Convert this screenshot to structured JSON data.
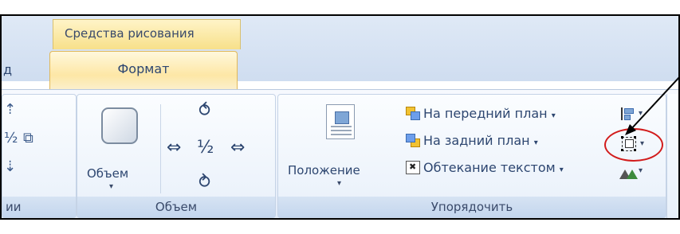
{
  "context_tab_header": "Средства рисования",
  "tabs": {
    "previous_partial": "д",
    "format": "Формат"
  },
  "groups": {
    "left_partial": {
      "label": "ии"
    },
    "volume": {
      "label": "Объем",
      "button_label": "Объем",
      "dropdown": "▾"
    },
    "arrange": {
      "label": "Упорядочить",
      "position_label": "Положение",
      "dropdown": "▾",
      "bring_front": "На передний план",
      "send_back": "На задний план",
      "text_wrap": "Обтекание текстом",
      "menu_arrow": "▾"
    }
  },
  "colors": {
    "accent_tab": "#fde7a6",
    "ribbon": "#e2ebf8",
    "highlight_circle": "#d21c1c",
    "text": "#2d4670"
  }
}
